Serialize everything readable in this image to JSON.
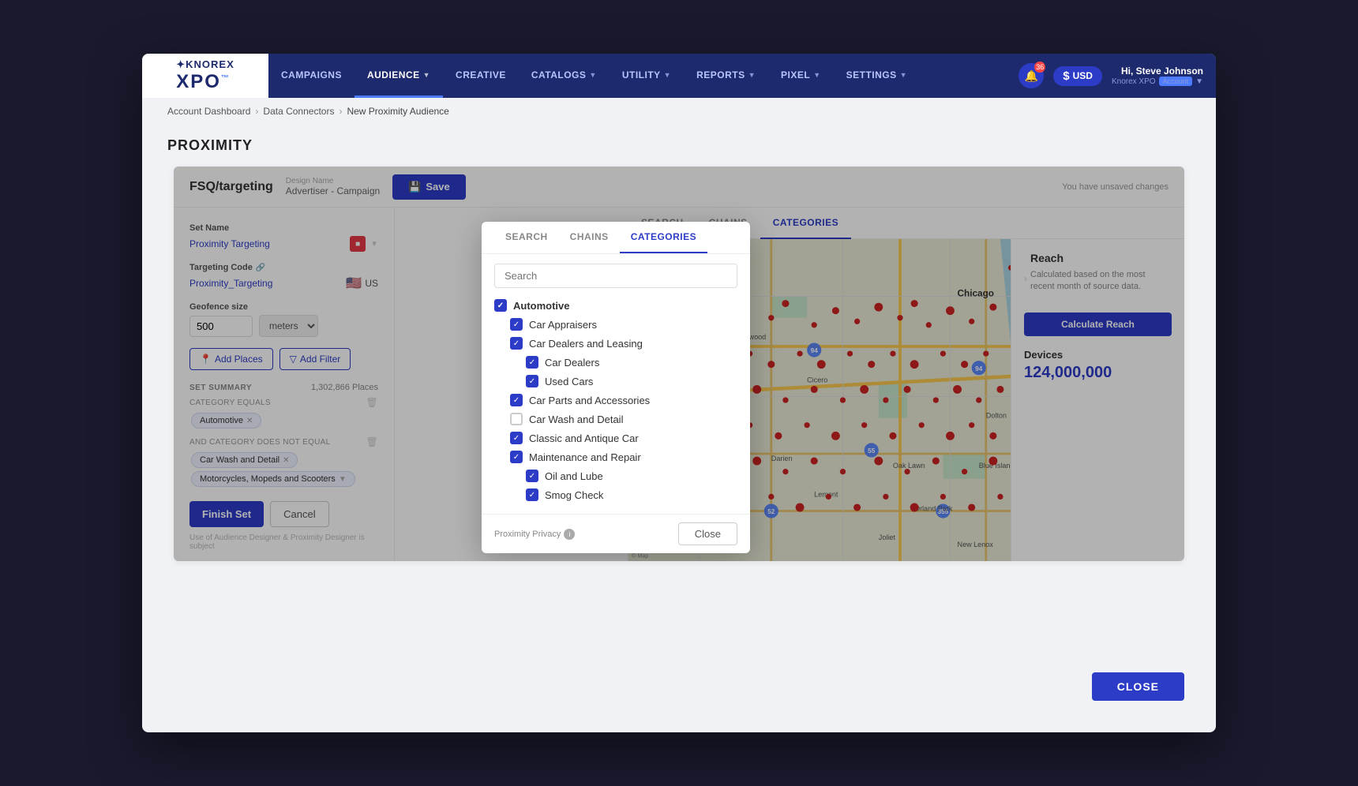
{
  "app": {
    "name": "Knorex XPO"
  },
  "nav": {
    "items": [
      {
        "label": "CAMPAIGNS",
        "active": false,
        "hasDropdown": false
      },
      {
        "label": "AUDIENCE",
        "active": true,
        "hasDropdown": true
      },
      {
        "label": "CREATIVE",
        "active": false,
        "hasDropdown": false
      },
      {
        "label": "CATALOGS",
        "active": false,
        "hasDropdown": true
      },
      {
        "label": "UTILITY",
        "active": false,
        "hasDropdown": true
      },
      {
        "label": "REPORTS",
        "active": false,
        "hasDropdown": true
      },
      {
        "label": "PIXEL",
        "active": false,
        "hasDropdown": true
      },
      {
        "label": "SETTINGS",
        "active": false,
        "hasDropdown": true
      }
    ],
    "notification_count": "36",
    "currency": "USD",
    "user_greeting": "Hi, Steve Johnson",
    "user_platform": "Knorex XPO",
    "user_account_label": "Account"
  },
  "breadcrumb": {
    "items": [
      {
        "label": "Account Dashboard",
        "link": true
      },
      {
        "label": "Data Connectors",
        "link": true
      },
      {
        "label": "New Proximity Audience",
        "link": false
      }
    ]
  },
  "page": {
    "title": "PROXIMITY"
  },
  "panel": {
    "fsq_label": "FSQ/targeting",
    "design_name_label": "Design Name",
    "design_name_value": "Advertiser - Campaign",
    "save_label": "Save",
    "unsaved_msg": "You have unsaved changes"
  },
  "sidebar": {
    "set_name_label": "Set Name",
    "set_name_value": "Proximity Targeting",
    "targeting_code_label": "Targeting Code",
    "targeting_code_value": "Proximity_Targeting",
    "targeting_code_region": "US",
    "geofence_label": "Geofence size",
    "geofence_value": "500",
    "geofence_unit": "meters",
    "add_places_label": "Add Places",
    "add_filter_label": "Add Filter",
    "set_summary_label": "SET SUMMARY",
    "set_summary_count": "1,302,866 Places",
    "category_equals_label": "CATEGORY EQUALS",
    "category_equals_tag": "Automotive",
    "and_not_label": "AND CATEGORY DOES NOT EQUAL",
    "exclude_tag1": "Car Wash and Detail",
    "exclude_tag2": "Motorcycles, Mopeds and Scooters",
    "finish_label": "Finish Set",
    "cancel_label": "Cancel",
    "footer_note": "Use of Audience Designer & Proximity Designer is subject"
  },
  "map_tabs": [
    {
      "label": "SEARCH",
      "active": false
    },
    {
      "label": "CHAINS",
      "active": false
    },
    {
      "label": "CATEGORIES",
      "active": true
    }
  ],
  "reach_panel": {
    "title": "Reach",
    "desc": "Calculated based on the most recent month of source data.",
    "calc_label": "Calculate Reach",
    "devices_label": "Devices",
    "devices_value": "124,000,000"
  },
  "dialog": {
    "tabs": [
      {
        "label": "SEARCH",
        "active": false
      },
      {
        "label": "CHAINS",
        "active": false
      },
      {
        "label": "CATEGORIES",
        "active": true
      }
    ],
    "search_placeholder": "Search",
    "categories": [
      {
        "label": "Automotive",
        "level": "parent",
        "checked": true
      },
      {
        "label": "Car Appraisers",
        "level": "child",
        "checked": true
      },
      {
        "label": "Car Dealers and Leasing",
        "level": "child",
        "checked": true
      },
      {
        "label": "Car Dealers",
        "level": "grandchild",
        "checked": true
      },
      {
        "label": "Used Cars",
        "level": "grandchild",
        "checked": true
      },
      {
        "label": "Car Parts and Accessories",
        "level": "child",
        "checked": true
      },
      {
        "label": "Car Wash and Detail",
        "level": "child",
        "checked": false
      },
      {
        "label": "Classic and Antique Car",
        "level": "child",
        "checked": true
      },
      {
        "label": "Maintenance and Repair",
        "level": "child",
        "checked": true
      },
      {
        "label": "Oil and Lube",
        "level": "grandchild",
        "checked": true
      },
      {
        "label": "Smog Check",
        "level": "grandchild",
        "checked": true
      }
    ],
    "privacy_label": "Proximity Privacy",
    "close_label": "Close"
  },
  "bottom_close_label": "CLOSE"
}
